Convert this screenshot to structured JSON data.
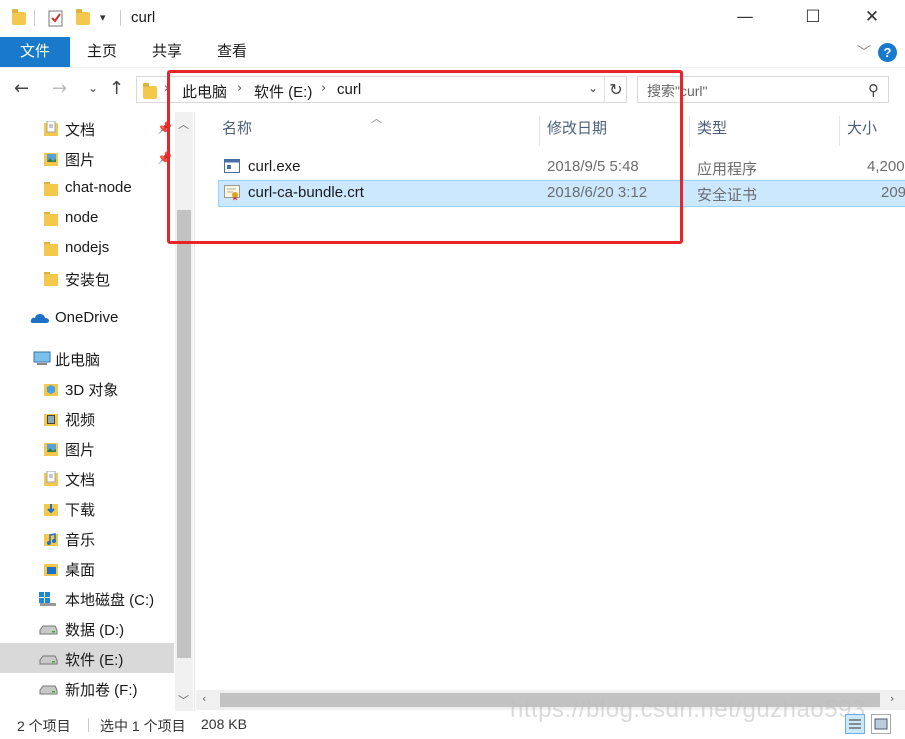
{
  "window": {
    "title": "curl",
    "minimize": "—",
    "maximize": "☐",
    "close": "✕"
  },
  "ribbon": {
    "tabs": [
      "文件",
      "主页",
      "共享",
      "查看"
    ],
    "help": "?"
  },
  "address": {
    "crumbs": [
      "此电脑",
      "软件 (E:)",
      "curl"
    ]
  },
  "search": {
    "placeholder": "搜索\"curl\""
  },
  "sidebar": {
    "items": [
      {
        "label": "文档",
        "icon": "documents-folder-icon",
        "pinned": true
      },
      {
        "label": "图片",
        "icon": "pictures-folder-icon",
        "pinned": true
      },
      {
        "label": "chat-node",
        "icon": "folder-icon"
      },
      {
        "label": "node",
        "icon": "folder-icon"
      },
      {
        "label": "nodejs",
        "icon": "folder-icon"
      },
      {
        "label": "安装包",
        "icon": "folder-icon"
      },
      {
        "label": "OneDrive",
        "icon": "onedrive-cloud-icon"
      },
      {
        "label": "此电脑",
        "icon": "this-pc-icon"
      },
      {
        "label": "3D 对象",
        "icon": "3d-objects-icon"
      },
      {
        "label": "视频",
        "icon": "videos-icon"
      },
      {
        "label": "图片",
        "icon": "pictures-folder-icon"
      },
      {
        "label": "文档",
        "icon": "documents-folder-icon"
      },
      {
        "label": "下载",
        "icon": "downloads-icon"
      },
      {
        "label": "音乐",
        "icon": "music-icon"
      },
      {
        "label": "桌面",
        "icon": "desktop-icon"
      },
      {
        "label": "本地磁盘 (C:)",
        "icon": "windows-drive-icon"
      },
      {
        "label": "数据 (D:)",
        "icon": "drive-icon"
      },
      {
        "label": "软件 (E:)",
        "icon": "drive-icon",
        "selected": true
      },
      {
        "label": "新加卷 (F:)",
        "icon": "drive-icon"
      }
    ]
  },
  "files": {
    "columns": {
      "name": "名称",
      "modified": "修改日期",
      "type": "类型",
      "size": "大小"
    },
    "rows": [
      {
        "name": "curl.exe",
        "modified": "2018/9/5 5:48",
        "type": "应用程序",
        "size": "4,200",
        "icon": "exe-file-icon",
        "selected": false
      },
      {
        "name": "curl-ca-bundle.crt",
        "modified": "2018/6/20 3:12",
        "type": "安全证书",
        "size": "209",
        "icon": "certificate-file-icon",
        "selected": true
      }
    ]
  },
  "status": {
    "count": "2 个项目",
    "selection": "选中 1 个项目",
    "size": "208 KB"
  },
  "watermark": "https://blog.csdn.net/guzhao593",
  "colors": {
    "accent": "#1979ca",
    "highlight_box": "#e8262a",
    "selection_bg": "#cce8ff",
    "folder": "#f3c84d"
  }
}
